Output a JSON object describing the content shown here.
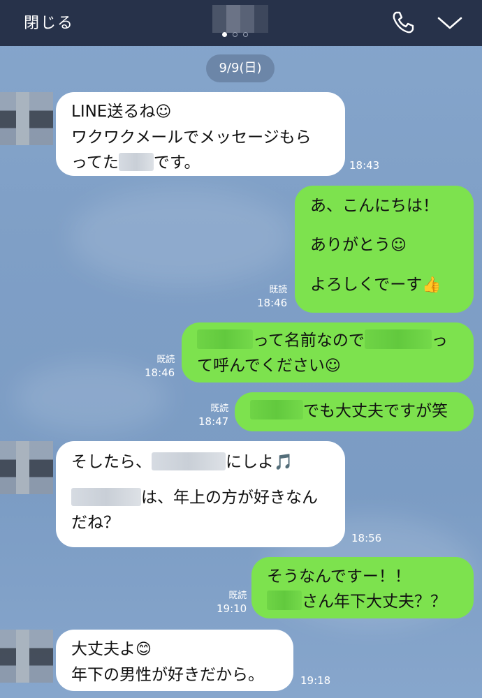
{
  "header": {
    "close_label": "閉じる",
    "page_dots": 3,
    "active_dot": 0
  },
  "date_label": "9/9(日)",
  "messages": [
    {
      "side": "in",
      "lines": [
        "LINE送るね☺️",
        "ワクワクメールでメッセージもら",
        "ってた▢です。"
      ],
      "time": "18:43"
    },
    {
      "side": "out",
      "lines": [
        "あ、こんにちは！",
        "ありがとう☺️",
        "よろしくでーす👍"
      ],
      "read": "既読",
      "time": "18:46"
    },
    {
      "side": "out",
      "lines": [
        "▢って名前なので▢っ",
        "て呼んでください☺️"
      ],
      "read": "既読",
      "time": "18:46"
    },
    {
      "side": "out",
      "lines": [
        "▢でも大丈夫ですが笑"
      ],
      "read": "既読",
      "time": "18:47"
    },
    {
      "side": "in",
      "lines": [
        "そしたら、▢にしよ🎵",
        "▢は、年上の方が好きなん",
        "だね？"
      ],
      "time": "18:56"
    },
    {
      "side": "out",
      "lines": [
        "そうなんですー！！",
        "▢さん年下大丈夫？？"
      ],
      "read": "既読",
      "time": "19:10"
    },
    {
      "side": "in",
      "lines": [
        "大丈夫よ😊",
        "年下の男性が好きだから。"
      ],
      "time": "19:18"
    }
  ],
  "text": {
    "m1_l1": "LINE送るね",
    "m1_e1": "☺",
    "m1_l2": "ワクワクメールでメッセージもら",
    "m1_l3a": "ってた",
    "m1_l3b": "です。",
    "m1_time": "18:43",
    "m2_l1": "あ、こんにちは！",
    "m2_l2": "ありがとう",
    "m2_e2": "☺",
    "m2_l3": "よろしくでーす",
    "m2_e3": "👍",
    "m2_read": "既読",
    "m2_time": "18:46",
    "m3_l1a": "って名前なので",
    "m3_l1b": "っ",
    "m3_l2": "て呼んでください",
    "m3_e2": "☺",
    "m3_read": "既読",
    "m3_time": "18:46",
    "m4_l1": "でも大丈夫ですが笑",
    "m4_read": "既読",
    "m4_time": "18:47",
    "m5_l1a": "そしたら、",
    "m5_l1b": "にしよ",
    "m5_e1": "🎵",
    "m5_l2": "は、年上の方が好きなん",
    "m5_l3": "だね？",
    "m5_time": "18:56",
    "m6_l1": "そうなんですー！！",
    "m6_l2": "さん年下大丈夫？？",
    "m6_read": "既読",
    "m6_time": "19:10",
    "m7_l1": "大丈夫よ",
    "m7_e1": "😊",
    "m7_l2": "年下の男性が好きだから。",
    "m7_time": "19:18"
  }
}
